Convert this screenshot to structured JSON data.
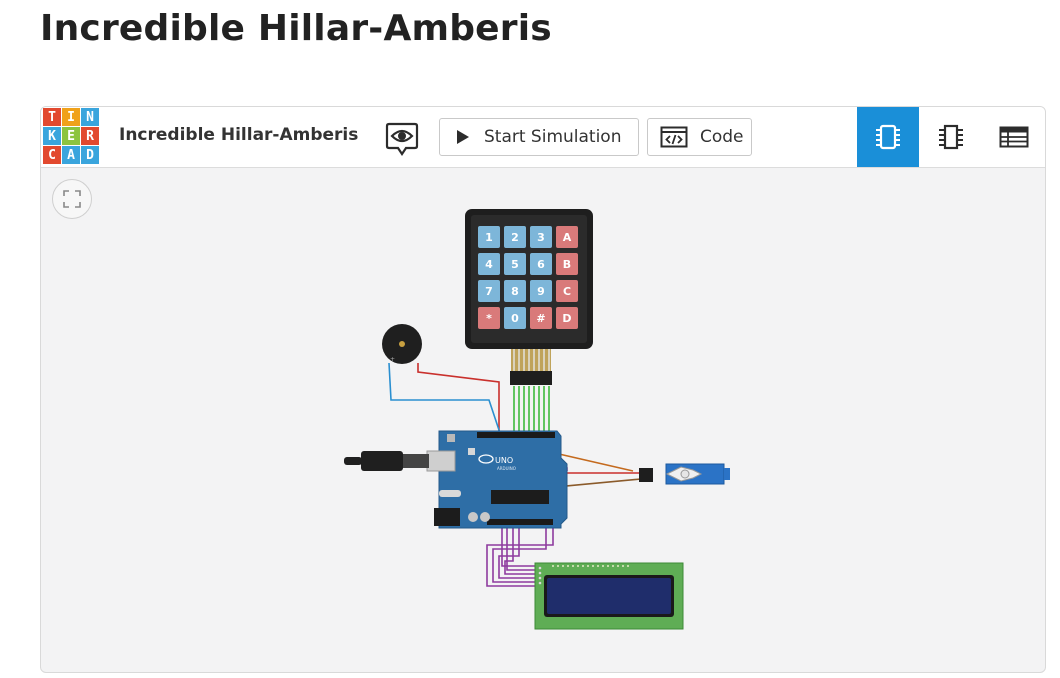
{
  "page": {
    "title": "Incredible Hillar-Amberis"
  },
  "logo": {
    "letters": [
      "T",
      "I",
      "N",
      "K",
      "E",
      "R",
      "C",
      "A",
      "D"
    ]
  },
  "toolbar": {
    "design_title": "Incredible Hillar-Amberis",
    "start_simulation_label": "Start Simulation",
    "code_label": "Code"
  },
  "keypad": {
    "keys": [
      "1",
      "2",
      "3",
      "A",
      "4",
      "5",
      "6",
      "B",
      "7",
      "8",
      "9",
      "C",
      "*",
      "0",
      "#",
      "D"
    ]
  },
  "arduino": {
    "brand_text": "UNO",
    "sub_text": "ARDUINO"
  },
  "colors": {
    "accent": "#1a8fd8",
    "logo": [
      "#e2492f",
      "#f0a11a",
      "#3aa5dd",
      "#3aa5dd",
      "#8cc43f",
      "#e2492f",
      "#e2492f",
      "#3aa5dd",
      "#3aa5dd"
    ],
    "key_blue": "#7db6d9",
    "key_red": "#d97a7a"
  },
  "icons": {
    "fit": "fit-screen-icon",
    "eye": "eye-speech-icon",
    "play": "play-icon",
    "code": "code-window-icon",
    "circuit_view": "chip-icon",
    "schematic_view": "schematic-icon",
    "component_list": "table-list-icon"
  }
}
